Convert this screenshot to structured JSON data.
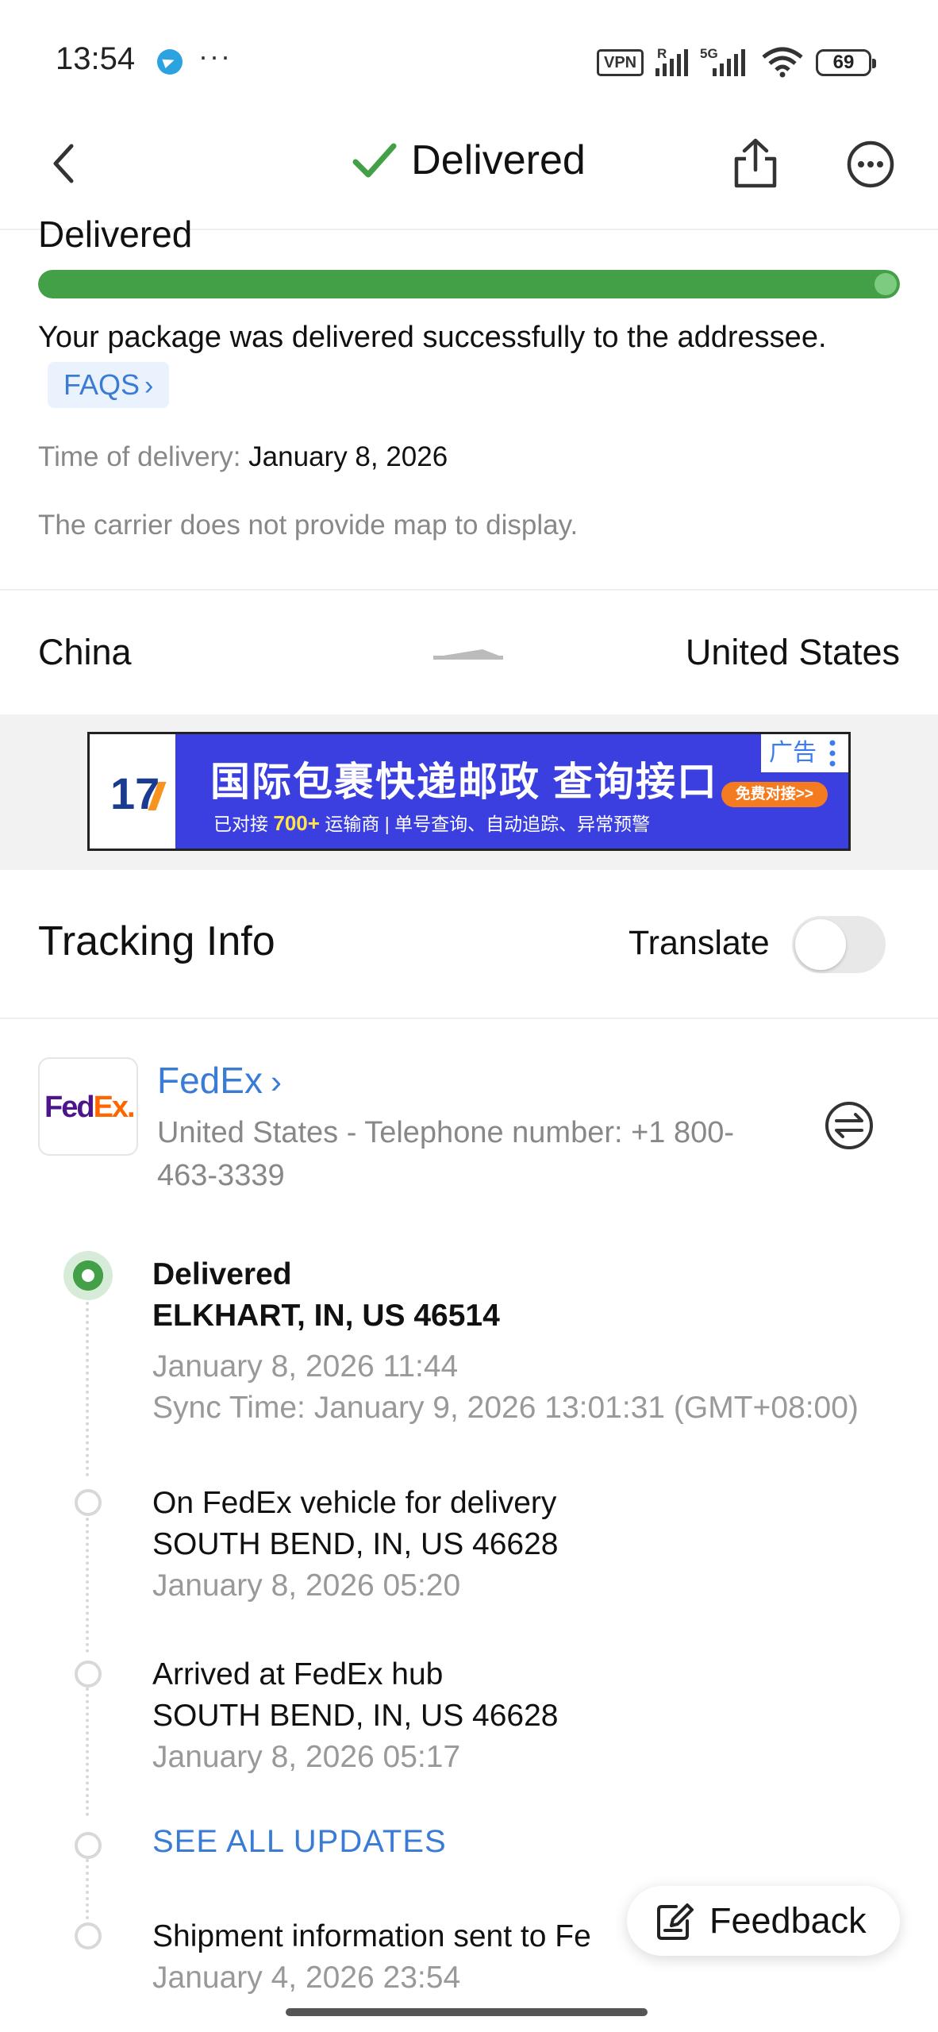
{
  "status_bar": {
    "time": "13:54",
    "dots": "···",
    "vpn": "VPN",
    "sig1_tag": "R",
    "sig2_tag": "5G",
    "battery": "69",
    "icons": [
      "telegram-icon",
      "signal-icon",
      "wifi-icon",
      "battery-icon"
    ]
  },
  "appbar": {
    "title": "Delivered",
    "icons": [
      "back-icon",
      "check-icon",
      "share-icon",
      "more-icon"
    ]
  },
  "delivery": {
    "section_title": "Delivered",
    "progress": 1.0,
    "message": "Your package was delivered successfully to the addressee.",
    "faqs_label": "FAQS",
    "time_label": "Time of delivery: ",
    "time_value": "January 8, 2026",
    "map_note": "The carrier does not provide map to display."
  },
  "route": {
    "from": "China",
    "to": "United States"
  },
  "ad": {
    "logo": "17",
    "headline": "国际包裹快递邮政 查询接口",
    "sub_prefix": "已对接 ",
    "sub_count": "700+",
    "sub_suffix": " 运输商  |  单号查询、自动追踪、异常预警",
    "tag": "广告",
    "button": "免费对接>>"
  },
  "tracking": {
    "title": "Tracking Info",
    "translate_label": "Translate",
    "translate_on": false
  },
  "carrier": {
    "logo_fed": "Fed",
    "logo_ex": "Ex.",
    "name": "FedEx",
    "info": "United States - Telephone number: +1 800-463-3339"
  },
  "events": [
    {
      "status": "Delivered",
      "location": "ELKHART, IN, US 46514",
      "time": "January 8, 2026 11:44",
      "sync": "Sync Time: January 9, 2026 13:01:31 (GMT+08:00)"
    },
    {
      "status": "On FedEx vehicle for delivery",
      "location": "SOUTH BEND, IN, US 46628",
      "time": "January 8, 2026 05:20"
    },
    {
      "status": "Arrived at FedEx hub",
      "location": "SOUTH BEND, IN, US 46628",
      "time": "January 8, 2026 05:17"
    },
    {
      "status": "Shipment information sent to Fe",
      "time": "January 4, 2026 23:54"
    }
  ],
  "see_all": "SEE ALL UPDATES",
  "feedback": {
    "label": "Feedback"
  },
  "colors": {
    "accent_green": "#43a047",
    "link_blue": "#3a7bd5",
    "ad_blue": "#3b3fe0",
    "fedex_purple": "#4d148c",
    "fedex_orange": "#ff6600"
  }
}
